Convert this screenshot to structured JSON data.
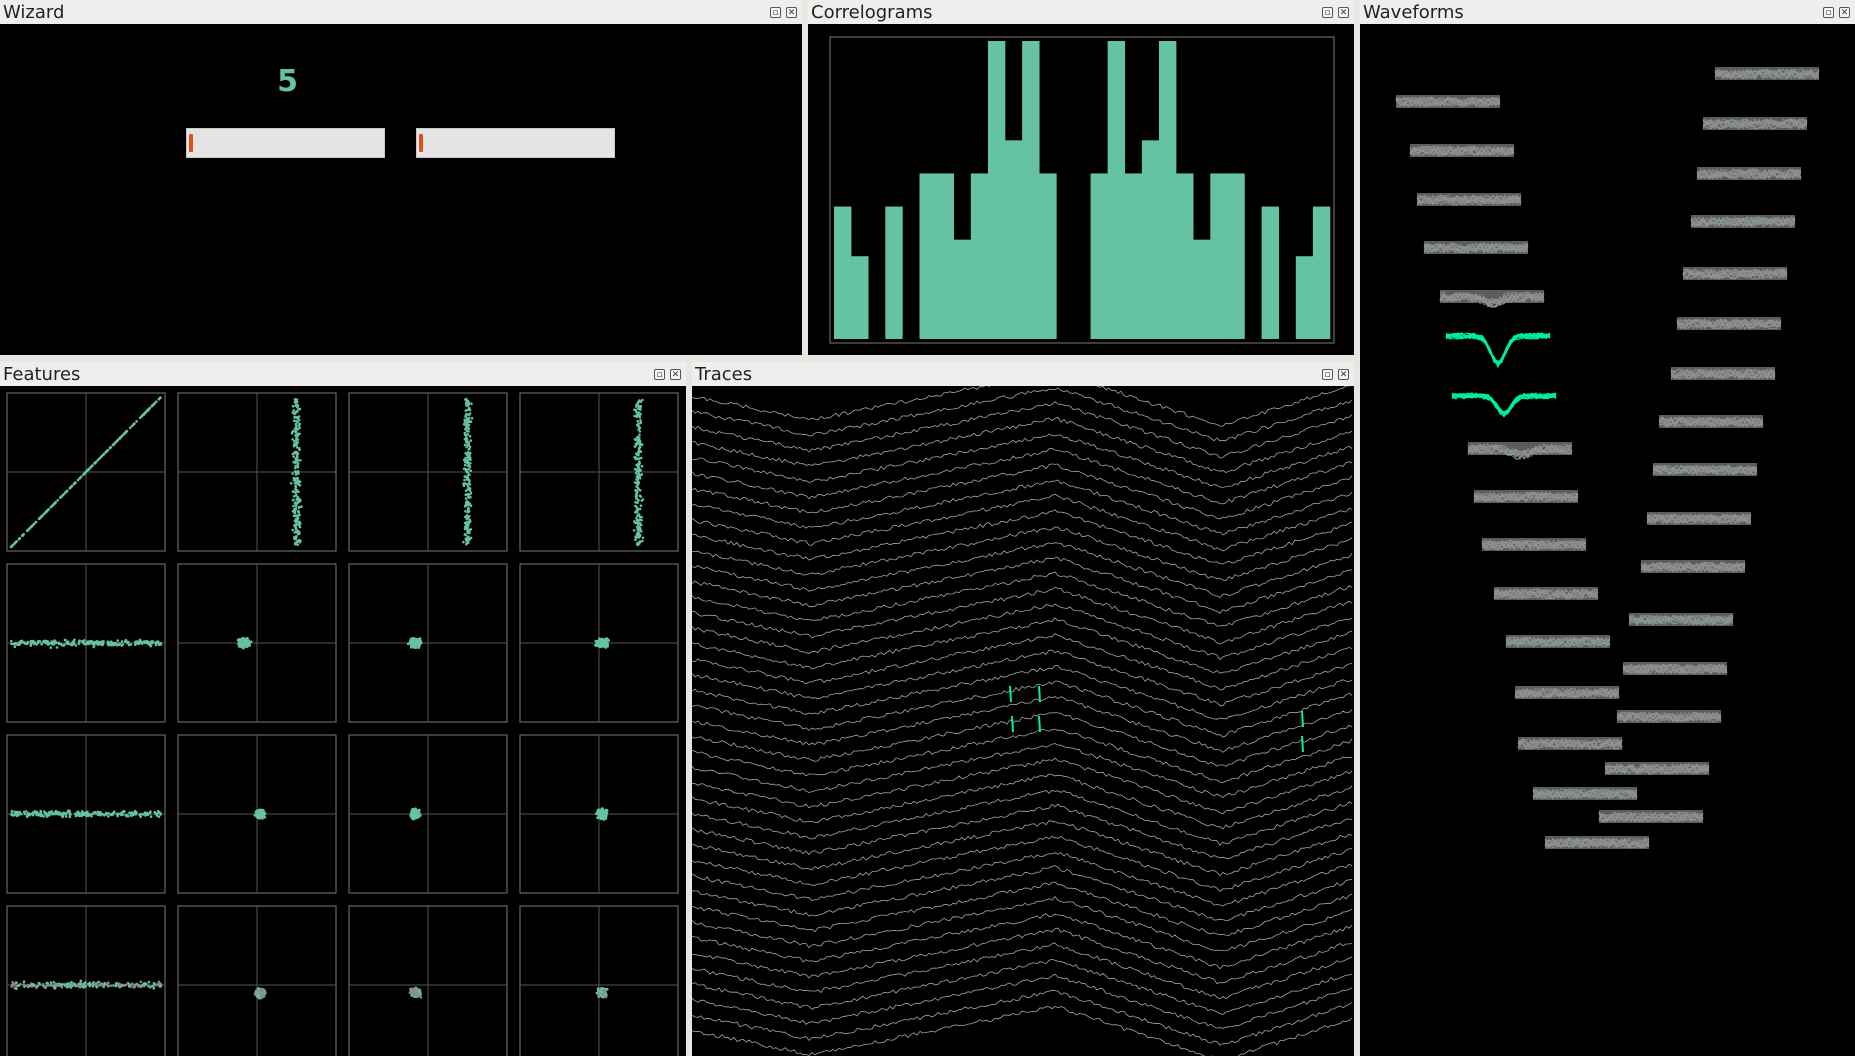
{
  "panels": {
    "wizard": {
      "title": "Wizard",
      "cluster_label": "5",
      "progress": [
        0.02,
        0.02
      ]
    },
    "correlograms": {
      "title": "Correlograms"
    },
    "waveforms": {
      "title": "Waveforms"
    },
    "features": {
      "title": "Features"
    },
    "traces": {
      "title": "Traces"
    }
  },
  "colors": {
    "accent": "#66c2a5",
    "bright": "#00f0a0",
    "trace": "#b8b8b8",
    "grid": "#555555",
    "frame": "#7a7a7a"
  },
  "icons": {
    "float": "restore-icon",
    "close": "close-icon"
  },
  "chart_data": {
    "type": "bar",
    "heights": [
      8,
      5,
      0,
      8,
      0,
      10,
      10,
      6,
      10,
      18,
      12,
      18,
      10,
      0,
      0,
      10,
      18,
      10,
      12,
      18,
      10,
      6,
      10,
      10,
      0,
      8,
      0,
      5,
      8
    ]
  }
}
